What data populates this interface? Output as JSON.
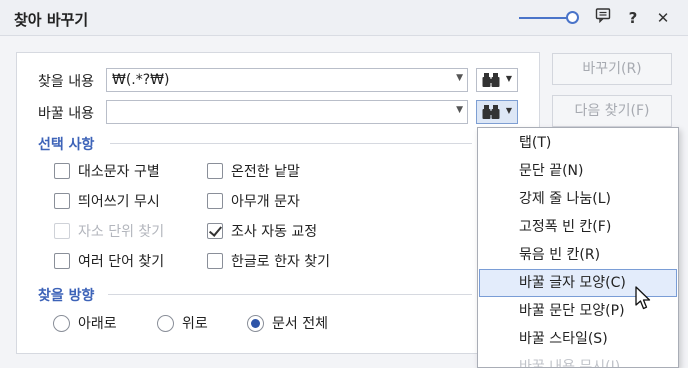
{
  "window": {
    "title": "찾아 바꾸기",
    "slider_level": 0.85,
    "icons": [
      "slider",
      "comment-icon",
      "help-icon",
      "close-icon"
    ]
  },
  "fields": {
    "find_label": "찾을 내용",
    "find_value": "₩(.*?₩)",
    "replace_label": "바꿀 내용",
    "replace_value": ""
  },
  "options": {
    "title": "선택 사항",
    "items": [
      {
        "label": "대소문자 구별",
        "checked": false,
        "disabled": false
      },
      {
        "label": "온전한 낱말",
        "checked": false,
        "disabled": false
      },
      {
        "label": "띄어쓰기 무시",
        "checked": false,
        "disabled": false
      },
      {
        "label": "아무개 문자",
        "checked": false,
        "disabled": false
      },
      {
        "label": "자소 단위 찾기",
        "checked": false,
        "disabled": true
      },
      {
        "label": "조사 자동 교정",
        "checked": true,
        "disabled": false
      },
      {
        "label": "여러 단어 찾기",
        "checked": false,
        "disabled": false
      },
      {
        "label": "한글로 한자 찾기",
        "checked": false,
        "disabled": false
      }
    ]
  },
  "direction": {
    "title": "찾을 방향",
    "options": [
      "아래로",
      "위로",
      "문서 전체"
    ],
    "selected": "문서 전체"
  },
  "buttons": {
    "replace": "바꾸기(R)",
    "find_next": "다음 찾기(F)"
  },
  "menu": {
    "items": [
      "탭(T)",
      "문단 끝(N)",
      "강제 줄 나눔(L)",
      "고정폭 빈 칸(F)",
      "묶음 빈 칸(R)",
      "바꿀 글자 모양(C)",
      "바꿀 문단 모양(P)",
      "바꿀 스타일(S)",
      "바꿀 내용 무시(I)"
    ],
    "highlighted_index": 5
  },
  "colors": {
    "accent": "#3d63b8",
    "highlight": "#e3ecfb"
  }
}
